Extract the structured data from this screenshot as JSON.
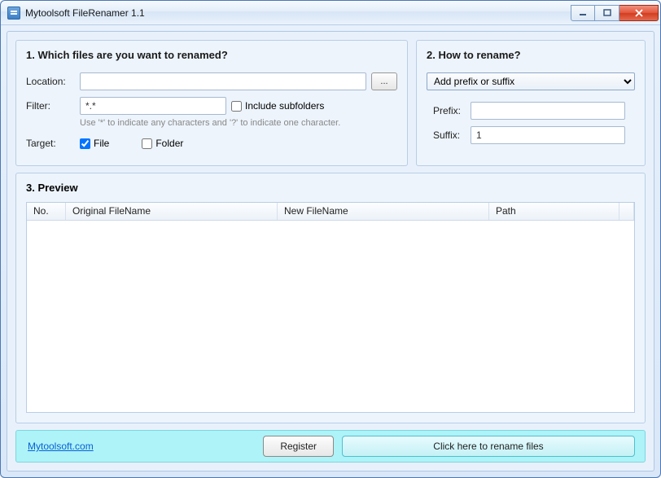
{
  "window": {
    "title": "Mytoolsoft FileRenamer 1.1"
  },
  "section1": {
    "heading": "1. Which files are you want to renamed?",
    "location_label": "Location:",
    "location_value": "",
    "browse_label": "...",
    "filter_label": "Filter:",
    "filter_value": "*.*",
    "include_subfolders_label": "Include subfolders",
    "include_subfolders_checked": false,
    "hint": "Use '*' to indicate any characters and '?' to indicate one character.",
    "target_label": "Target:",
    "file_label": "File",
    "file_checked": true,
    "folder_label": "Folder",
    "folder_checked": false
  },
  "section2": {
    "heading": "2. How to rename?",
    "method_selected": "Add prefix or suffix",
    "prefix_label": "Prefix:",
    "prefix_value": "",
    "suffix_label": "Suffix:",
    "suffix_value": "1"
  },
  "preview": {
    "heading": "3. Preview",
    "columns": {
      "no": "No.",
      "original": "Original FileName",
      "new": "New FileName",
      "path": "Path"
    }
  },
  "footer": {
    "brand": "Mytoolsoft.com",
    "register": "Register",
    "rename": "Click here to rename files"
  }
}
